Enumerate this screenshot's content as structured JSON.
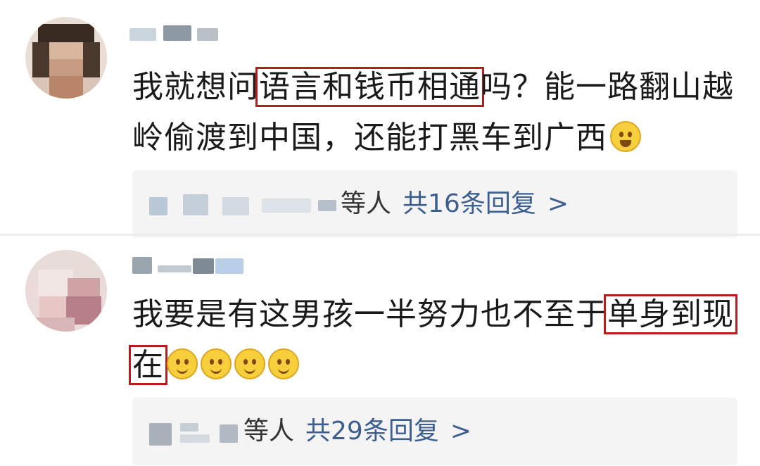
{
  "comments": [
    {
      "text_parts": {
        "before": "我就想问",
        "highlight": "语言和钱币相通",
        "after_line1": "吗？能一路翻山越",
        "line2": "岭偷渡到中国，还能打黑车到广西"
      },
      "emoji": "laughing-tears-emoji",
      "replies": {
        "suffix": "等人",
        "count_label": "共16条回复",
        "chevron": ">"
      }
    },
    {
      "text_parts": {
        "before": "我要是有这男孩一半努力也不至于",
        "highlight_line1": "单身到现",
        "highlight_line2": "在"
      },
      "emoji": "slight-smile-emoji",
      "emoji_count": 4,
      "replies": {
        "suffix": "等人",
        "count_label": "共29条回复",
        "chevron": ">"
      }
    }
  ],
  "colors": {
    "highlight_box": "#b81d1d",
    "reply_link": "#3d5f8f",
    "reply_background": "#f4f4f4"
  }
}
